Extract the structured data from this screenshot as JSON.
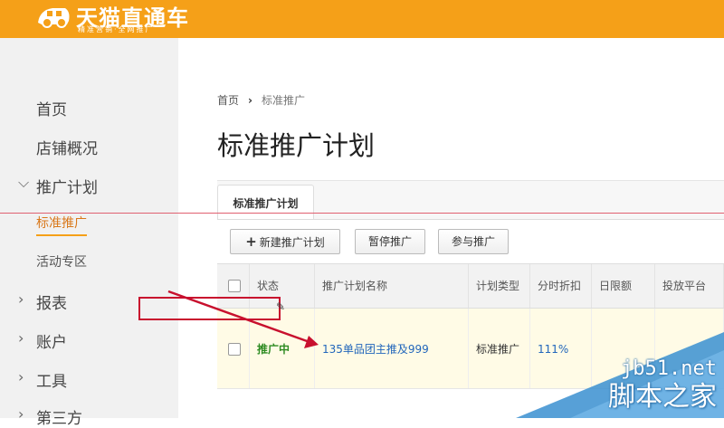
{
  "header": {
    "logo_text": "天猫直通车",
    "logo_subtitle": "精准营销·全网推广",
    "brand_color": "#f5a018"
  },
  "sidebar": {
    "items": [
      {
        "label": "首页"
      },
      {
        "label": "店铺概况"
      },
      {
        "label": "推广计划"
      },
      {
        "label": "标准推广"
      },
      {
        "label": "活动专区"
      },
      {
        "label": "报表"
      },
      {
        "label": "账户"
      },
      {
        "label": "工具"
      },
      {
        "label": "第三方"
      }
    ]
  },
  "breadcrumb": {
    "home": "首页",
    "separator": "›",
    "current": "标准推广"
  },
  "page": {
    "title": "标准推广计划"
  },
  "tabs": [
    {
      "label": "标准推广计划"
    }
  ],
  "toolbar": {
    "new_plan": "新建推广计划",
    "pause": "暂停推广",
    "join": "参与推广"
  },
  "table": {
    "headers": [
      "状态",
      "推广计划名称",
      "计划类型",
      "分时折扣",
      "日限额",
      "投放平台"
    ],
    "rows": [
      {
        "status": "推广中",
        "name": "135单品团主推及999",
        "type": "标准推广",
        "discount": "111%"
      }
    ],
    "status_color": "#2e8b22",
    "link_color": "#2266bb"
  },
  "annotation": {
    "highlight_color": "#c8102e"
  },
  "watermark": {
    "site": "jb51.net",
    "name": "脚本之家"
  }
}
